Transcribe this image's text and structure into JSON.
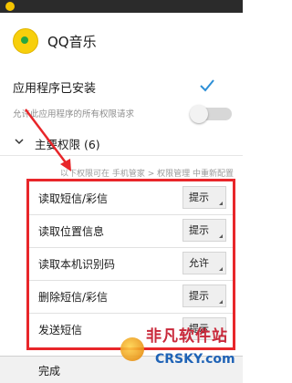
{
  "colors": {
    "accent": "#2d8fd6",
    "highlight": "#e8262a",
    "toggle_off": "#d7d7d7"
  },
  "app": {
    "title": "QQ音乐",
    "icon": "qq-music-logo-icon"
  },
  "installed": {
    "label": "应用程序已安装",
    "icon": "checkmark-icon"
  },
  "allow_all": {
    "label": "允许此应用程序的所有权限请求",
    "enabled": false
  },
  "section": {
    "label": "主要权限 (6)",
    "icon": "chevron-down-icon"
  },
  "hint": "以下权限可在 手机管家 > 权限管理 中重新配置",
  "permissions": [
    {
      "label": "读取短信/彩信",
      "value": "提示"
    },
    {
      "label": "读取位置信息",
      "value": "提示"
    },
    {
      "label": "读取本机识别码",
      "value": "允许"
    },
    {
      "label": "删除短信/彩信",
      "value": "提示"
    },
    {
      "label": "发送短信",
      "value": "提示"
    }
  ],
  "footer": {
    "done_label": "完成"
  },
  "watermark": {
    "cn": "非凡软件站",
    "en": "CRSKY.com"
  }
}
